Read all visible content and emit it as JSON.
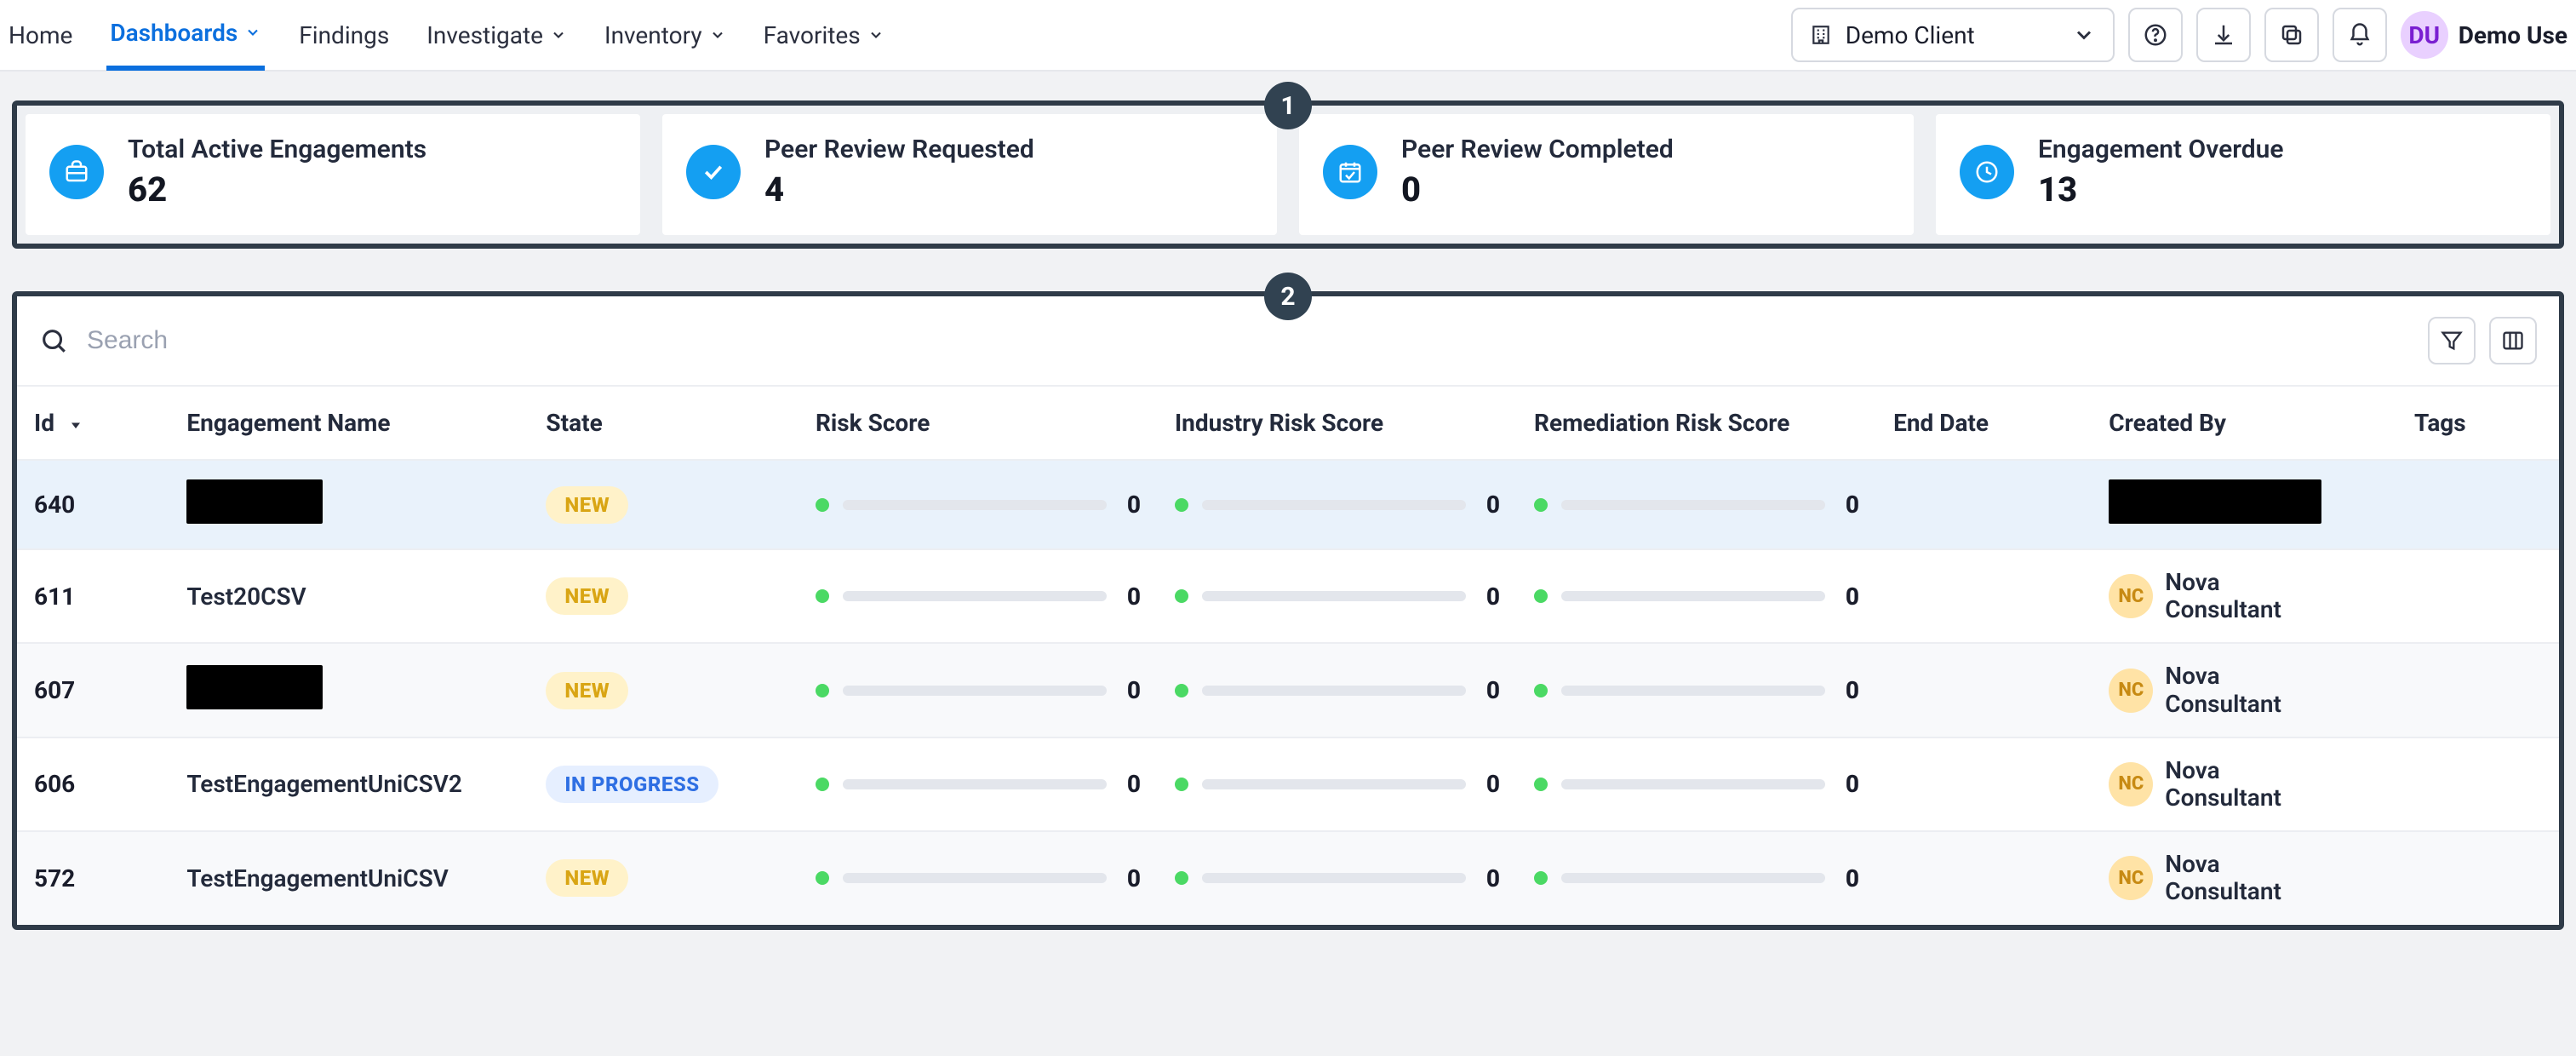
{
  "nav": {
    "items": [
      {
        "label": "Home"
      },
      {
        "label": "Dashboards",
        "has_menu": true,
        "active": true
      },
      {
        "label": "Findings"
      },
      {
        "label": "Investigate",
        "has_menu": true
      },
      {
        "label": "Inventory",
        "has_menu": true
      },
      {
        "label": "Favorites",
        "has_menu": true
      }
    ],
    "client": {
      "label": "Demo Client"
    },
    "user": {
      "initials": "DU",
      "name": "Demo Use"
    }
  },
  "section_badges": {
    "stats": "1",
    "table": "2"
  },
  "stats": [
    {
      "icon": "briefcase",
      "title": "Total Active Engagements",
      "value": "62"
    },
    {
      "icon": "check",
      "title": "Peer Review Requested",
      "value": "4"
    },
    {
      "icon": "calendar",
      "title": "Peer Review Completed",
      "value": "0"
    },
    {
      "icon": "clock",
      "title": "Engagement Overdue",
      "value": "13"
    }
  ],
  "table": {
    "search_placeholder": "Search",
    "columns": {
      "id": "Id",
      "name": "Engagement Name",
      "state": "State",
      "risk": "Risk Score",
      "industry": "Industry Risk Score",
      "remediation": "Remediation Risk Score",
      "end": "End Date",
      "creator": "Created By",
      "tags": "Tags"
    },
    "rows": [
      {
        "id": "640",
        "name_redacted": true,
        "name": "",
        "state": "NEW",
        "state_kind": "new",
        "risk": "0",
        "industry": "0",
        "remediation": "0",
        "end": "",
        "creator_redacted": true,
        "creator_initials": "",
        "creator_name": "",
        "selected": true
      },
      {
        "id": "611",
        "name_redacted": false,
        "name": "Test20CSV",
        "state": "NEW",
        "state_kind": "new",
        "risk": "0",
        "industry": "0",
        "remediation": "0",
        "end": "",
        "creator_redacted": false,
        "creator_initials": "NC",
        "creator_name": "Nova Consultant"
      },
      {
        "id": "607",
        "name_redacted": true,
        "name": "",
        "state": "NEW",
        "state_kind": "new",
        "risk": "0",
        "industry": "0",
        "remediation": "0",
        "end": "",
        "creator_redacted": false,
        "creator_initials": "NC",
        "creator_name": "Nova Consultant",
        "alt": true
      },
      {
        "id": "606",
        "name_redacted": false,
        "name": "TestEngagementUniCSV2",
        "state": "IN PROGRESS",
        "state_kind": "progress",
        "risk": "0",
        "industry": "0",
        "remediation": "0",
        "end": "",
        "creator_redacted": false,
        "creator_initials": "NC",
        "creator_name": "Nova Consultant"
      },
      {
        "id": "572",
        "name_redacted": false,
        "name": "TestEngagementUniCSV",
        "state": "NEW",
        "state_kind": "new",
        "risk": "0",
        "industry": "0",
        "remediation": "0",
        "end": "",
        "creator_redacted": false,
        "creator_initials": "NC",
        "creator_name": "Nova Consultant",
        "alt": true
      }
    ]
  }
}
